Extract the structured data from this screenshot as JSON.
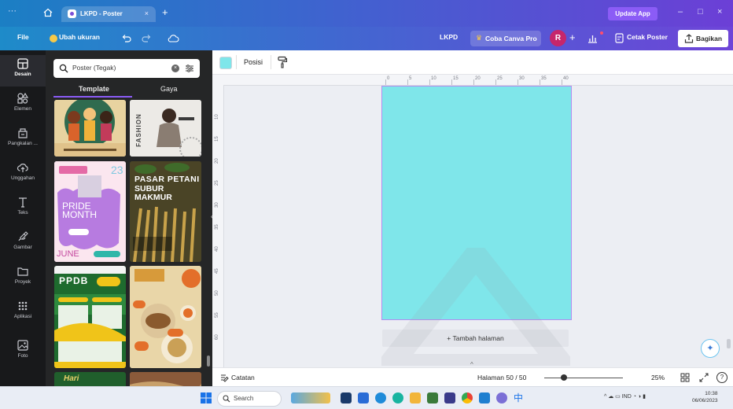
{
  "browser": {
    "menu_icon": "ellipsis-icon",
    "home_icon": "home-icon",
    "tab_title": "LKPD - Poster",
    "tab_close": "×",
    "new_tab": "+",
    "update_app": "Update App",
    "controls": [
      "–",
      "□",
      "×"
    ]
  },
  "toolbar": {
    "file": "File",
    "resize": "Ubah ukuran",
    "undo_icon": "undo-icon",
    "redo_icon": "redo-icon",
    "sync_icon": "cloud-sync-icon",
    "design_name": "LKPD",
    "try_pro": "Coba Canva Pro",
    "avatar_initial": "R",
    "add": "+",
    "chart_icon": "bar-chart-icon",
    "print": "Cetak Poster",
    "share": "Bagikan",
    "accent": "#8b5cf6"
  },
  "rail": [
    {
      "label": "Desain",
      "icon": "layout-icon",
      "active": true
    },
    {
      "label": "Elemen",
      "icon": "shapes-icon",
      "active": false
    },
    {
      "label": "Pangkalan ...",
      "icon": "brand-kit-icon",
      "active": false
    },
    {
      "label": "Unggahan",
      "icon": "cloud-upload-icon",
      "active": false
    },
    {
      "label": "Teks",
      "icon": "text-icon",
      "active": false
    },
    {
      "label": "Gambar",
      "icon": "draw-icon",
      "active": false
    },
    {
      "label": "Proyek",
      "icon": "folder-icon",
      "active": false
    },
    {
      "label": "Aplikasi",
      "icon": "apps-grid-icon",
      "active": false
    },
    {
      "label": "Foto",
      "icon": "photo-icon",
      "active": false
    }
  ],
  "panel": {
    "search_placeholder": "Poster (Tegak)",
    "tabs": [
      "Template",
      "Gaya"
    ],
    "templates": {
      "fashion": "FASHION",
      "pride_1": "PRIDE",
      "pride_2": "MONTH",
      "june": "JUNE",
      "pasar_1": "PASAR PETANI",
      "pasar_2": "SUBUR",
      "pasar_3": "MAKMUR",
      "ppdb": "PPDB",
      "hari": "Hari"
    }
  },
  "context_bar": {
    "background_color": "#7fe6ea",
    "position": "Posisi",
    "paint_icon": "paint-roller-icon"
  },
  "ruler": {
    "top": [
      "0",
      "5",
      "10",
      "15",
      "20",
      "25",
      "30",
      "35",
      "40"
    ],
    "left": [
      "10",
      "15",
      "20",
      "25",
      "30",
      "35",
      "40",
      "45",
      "50",
      "55",
      "60"
    ]
  },
  "canvas": {
    "page_color": "#7fe6ea",
    "add_page": "+ Tambah halaman"
  },
  "status": {
    "notes": "Catatan",
    "page_indicator": "Halaman 50 / 50",
    "zoom_fraction": 0.25,
    "zoom": "25%",
    "help": "?"
  },
  "taskbar": {
    "search": "Search",
    "tray": "IND",
    "time": "10:38",
    "date": "06/06/2023"
  }
}
